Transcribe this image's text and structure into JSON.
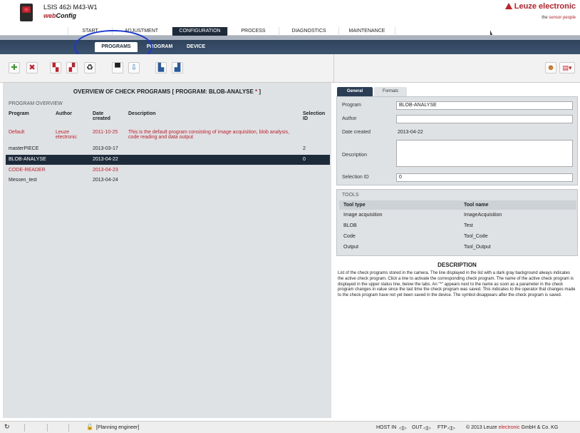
{
  "header": {
    "device_title": "LSIS 462i M43-W1",
    "app_name_prefix": "web",
    "app_name_suffix": "Config",
    "brand": "Leuze electronic",
    "tagline_part1": "the ",
    "tagline_part2": "sensor people"
  },
  "main_tabs": [
    {
      "label": "START"
    },
    {
      "label": "ADJUSTMENT"
    },
    {
      "label": "CONFIGURATION"
    },
    {
      "label": "PROCESS"
    },
    {
      "label": "DIAGNOSTICS"
    },
    {
      "label": "MAINTENANCE"
    }
  ],
  "sub_tabs": [
    {
      "label": "PROGRAMS"
    },
    {
      "label": "PROGRAM"
    },
    {
      "label": "DEVICE"
    }
  ],
  "toolbar": {
    "icons": [
      "add-icon",
      "delete-icon",
      "copy-icon",
      "paste-icon",
      "recycle-icon",
      "upload-icon",
      "download-icon",
      "import-icon",
      "export-icon"
    ],
    "right_icons": [
      "users-icon",
      "flag-icon"
    ]
  },
  "overview": {
    "title_prefix": "OVERVIEW OF CHECK PROGRAMS   [ PROGRAM: BLOB-ANALYSE ",
    "title_star": "*",
    "title_suffix": " ]",
    "section_label": "PROGRAM OVERVIEW",
    "columns": {
      "program": "Program",
      "author": "Author",
      "date": "Date created",
      "description": "Description",
      "selection": "Selection ID"
    },
    "rows": [
      {
        "program": "Default",
        "author": "Leuze electronic",
        "date": "2011-10-25",
        "description": "This is the default program consisting of image acquisition, blob analysis, code reading and data output",
        "selection": ""
      },
      {
        "program": "masterPIECE",
        "author": "",
        "date": "2013-03-17",
        "description": "",
        "selection": "2"
      },
      {
        "program": "BLOB-ANALYSE",
        "author": "",
        "date": "2013-04-22",
        "description": "",
        "selection": "0"
      },
      {
        "program": "CODE-READER",
        "author": "",
        "date": "2013-04-23",
        "description": "",
        "selection": ""
      },
      {
        "program": "Messen_test",
        "author": "",
        "date": "2013-04-24",
        "description": "",
        "selection": ""
      }
    ]
  },
  "details": {
    "tabs": [
      {
        "label": "General"
      },
      {
        "label": "Formats"
      }
    ],
    "program_label": "Program",
    "program_value": "BLOB-ANALYSE",
    "author_label": "Author",
    "author_value": "",
    "date_label": "Date created",
    "date_value": "2013-04-22",
    "description_label": "Description",
    "description_value": "",
    "selection_label": "Selection ID",
    "selection_value": "0"
  },
  "tools": {
    "section_label": "TOOLS",
    "col_type": "Tool type",
    "col_name": "Tool name",
    "rows": [
      {
        "type": "Image acquisition",
        "name": "ImageAcquisition"
      },
      {
        "type": "BLOB",
        "name": "Test"
      },
      {
        "type": "Code",
        "name": "Tool_Code"
      },
      {
        "type": "Output",
        "name": "Tool_Output"
      }
    ]
  },
  "description": {
    "title": "DESCRIPTION",
    "body": "List of the check programs stored in the camera. The line displayed in the list with a dark gray background always indicates the active check program. Click a line to activate the corresponding check program. The name of the active check program is displayed in the upper status line, below the tabs. An \"*\" appears next to the name as soon as a parameter in the check program changes in value since the last time the check program was saved. This indicates to the operator that changes made to the check program have not yet been saved in the device. The symbol disappears after the check program is saved."
  },
  "status": {
    "role": "[Planning engineer]",
    "host_in": "HOST IN",
    "out": "OUT",
    "ftp": "FTP",
    "copyright_prefix": "© 2013 Leuze ",
    "copyright_brand": "electronic",
    "copyright_suffix": " GmbH & Co. KG"
  },
  "colors": {
    "brand_red": "#c0202a",
    "nav_dark": "#1d2a3a",
    "panel_gray": "#dfe2e5"
  }
}
